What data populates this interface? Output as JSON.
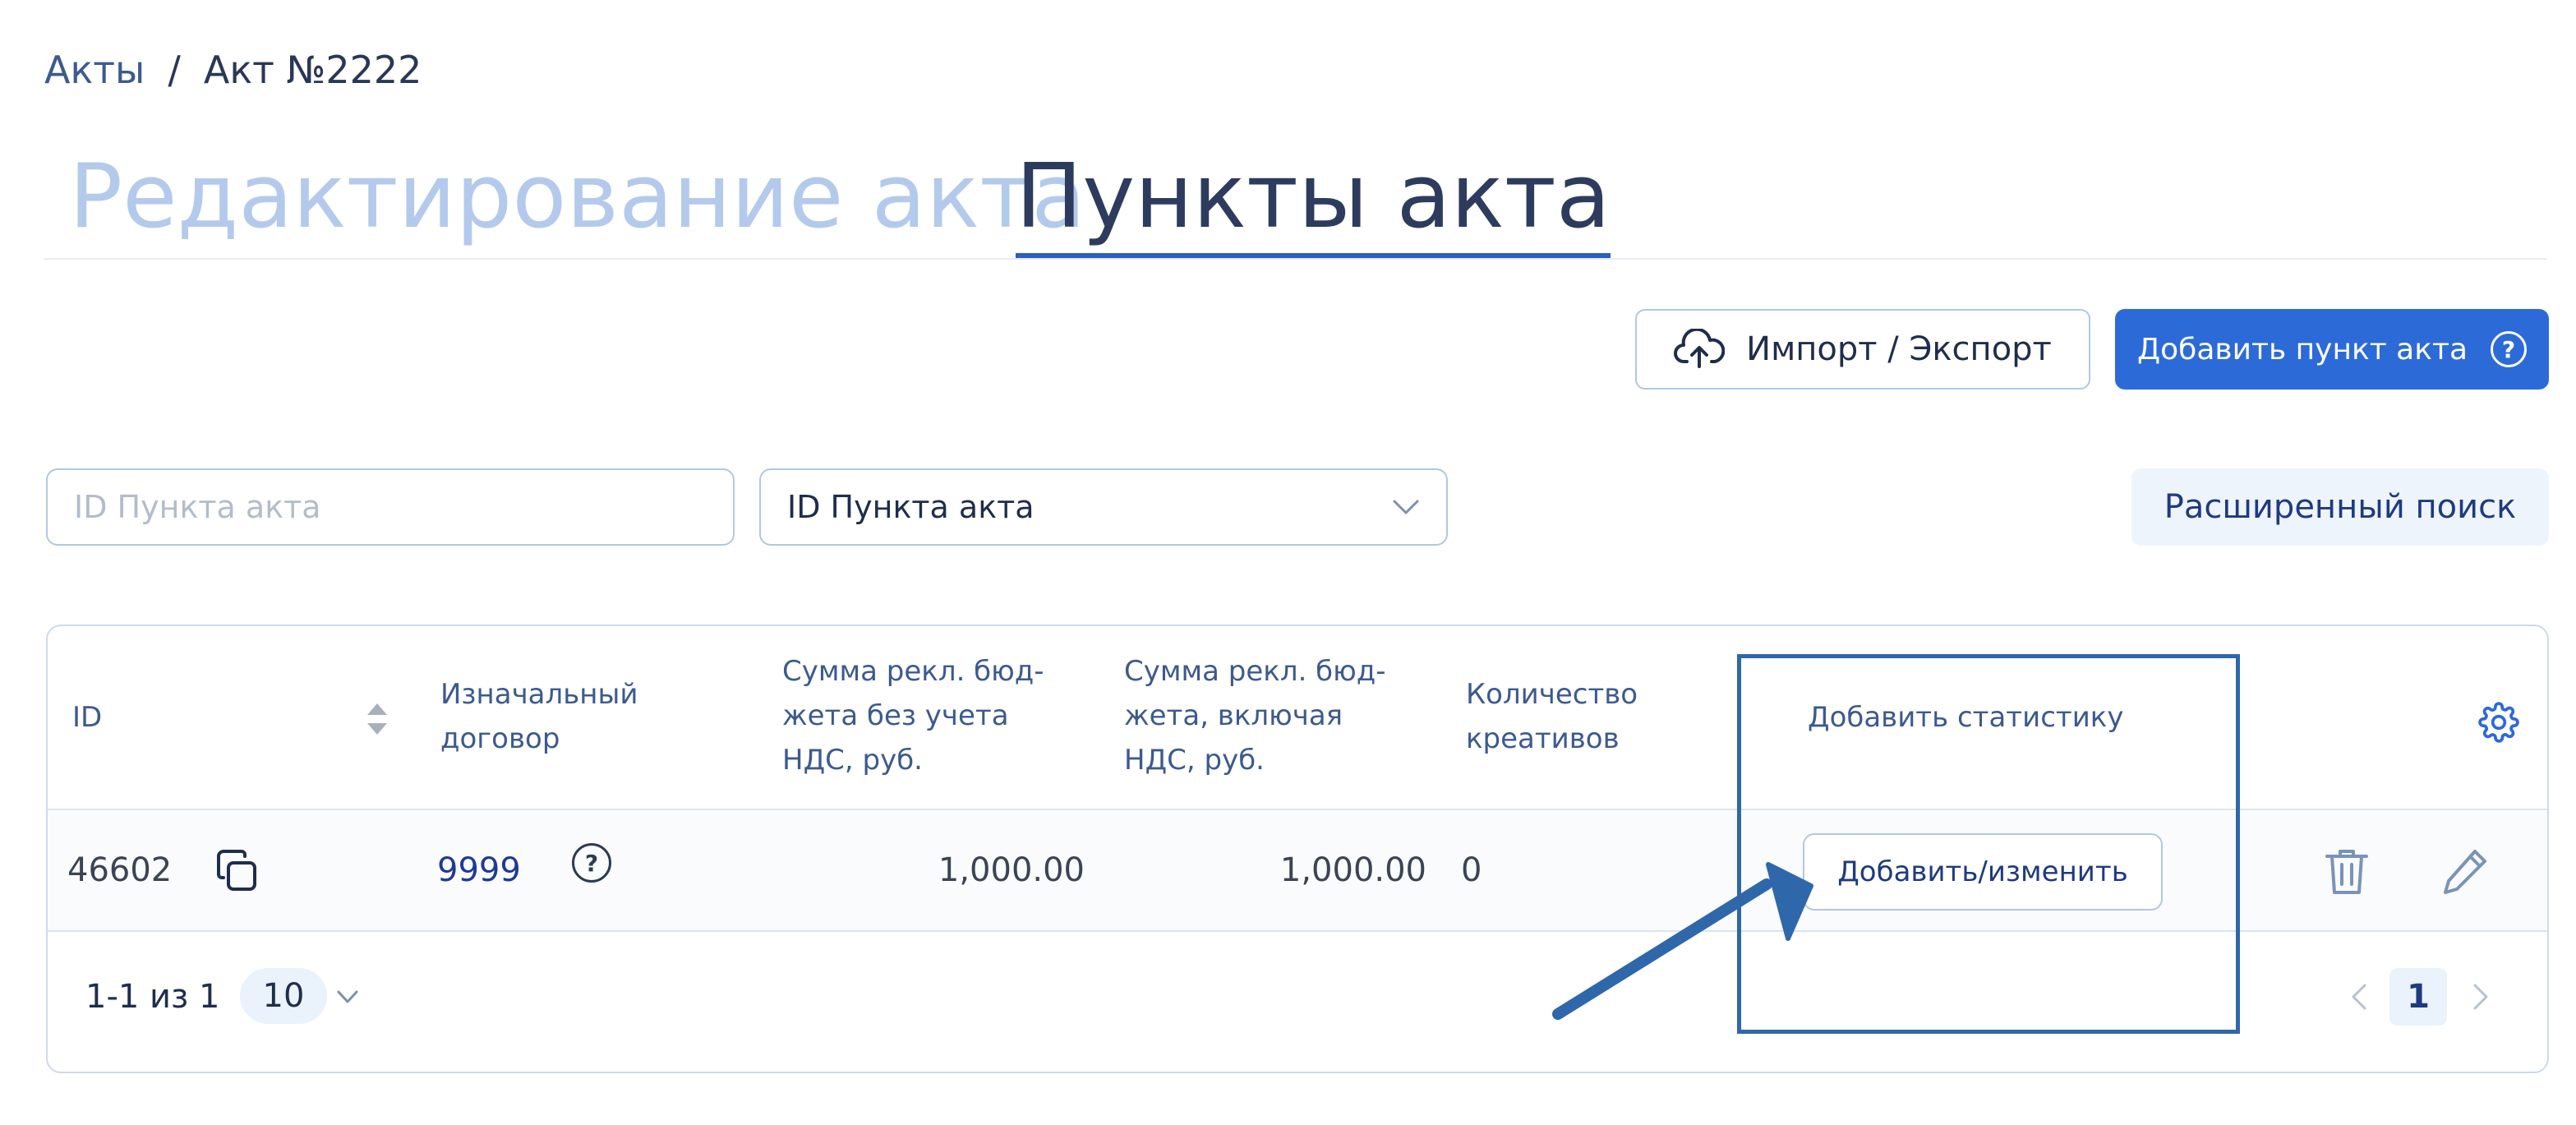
{
  "breadcrumb": {
    "parent": "Акты",
    "separator": "/",
    "current": "Акт №2222"
  },
  "tabs": [
    {
      "label": "Редактирование акта"
    },
    {
      "label": "Пункты акта"
    }
  ],
  "toolbar": {
    "import_label": "Импорт / Экспорт",
    "add_label": "Добавить пункт акта",
    "help_glyph": "?"
  },
  "filters": {
    "search_placeholder": "ID Пункта акта",
    "select_value": "ID Пункта акта",
    "advanced_label": "Расширенный поиск"
  },
  "table": {
    "columns": {
      "id": "ID",
      "contract": [
        "Изначальный",
        "договор"
      ],
      "sum_no_vat": [
        "Сумма рекл. бюд-",
        "жета без учета",
        "НДС, руб."
      ],
      "sum_vat": [
        "Сумма рекл. бюд-",
        "жета, включая",
        "НДС, руб."
      ],
      "count": [
        "Количество",
        "креативов"
      ],
      "stats": "Добавить статистику"
    },
    "rows": [
      {
        "id": "46602",
        "contract": "9999",
        "sum_no_vat": "1,000.00",
        "sum_vat": "1,000.00",
        "count": "0",
        "action_label": "Добавить/изменить"
      }
    ]
  },
  "pagination": {
    "range": "1-1 из 1",
    "page_size": "10",
    "current_page": "1"
  },
  "icons": [
    "cloud-upload-icon",
    "help-icon",
    "chevron-down-icon",
    "sort-icon",
    "gear-icon",
    "copy-icon",
    "trash-icon",
    "pencil-icon",
    "chevron-left-icon",
    "chevron-right-icon"
  ],
  "colors": {
    "accent": "#2c6ad8",
    "tab_inactive": "#b4caec",
    "annotation": "#2f67ab"
  }
}
